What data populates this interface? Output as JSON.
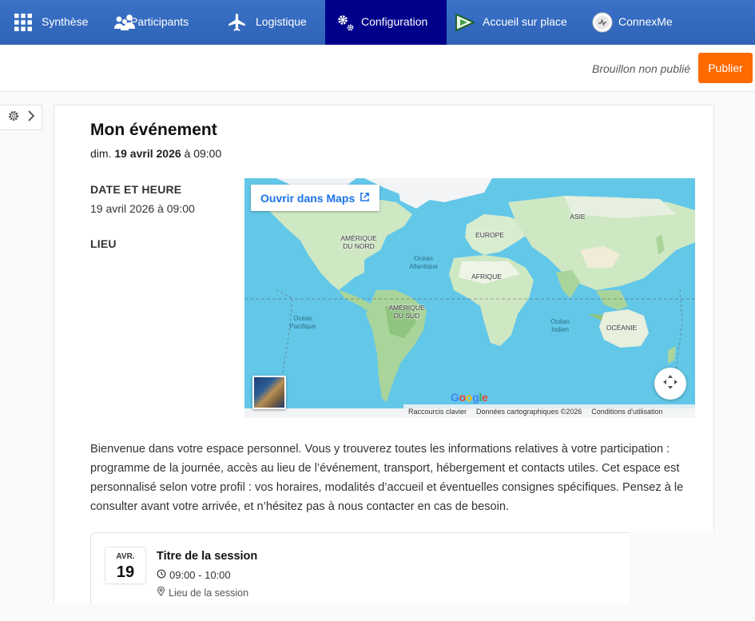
{
  "nav": {
    "items": [
      {
        "label": "Synthèse",
        "icon": "grid-icon"
      },
      {
        "label": "Participants",
        "icon": "people-icon"
      },
      {
        "label": "Logistique",
        "icon": "airplane-icon"
      },
      {
        "label": "Configuration",
        "icon": "gears-icon",
        "active": true
      },
      {
        "label": "Accueil sur place",
        "icon": "play-ticket-icon"
      },
      {
        "label": "ConnexMe",
        "icon": "connexme-logo-icon"
      }
    ]
  },
  "header": {
    "status": "Brouillon non publié",
    "publish_label": "Publier"
  },
  "event": {
    "title": "Mon événement",
    "when_prefix": "dim.",
    "when_date": "19 avril 2026",
    "when_suffix": "à 09:00",
    "date_label": "DATE ET HEURE",
    "date_value": "19 avril 2026 à 09:00",
    "place_label": "LIEU"
  },
  "map": {
    "open_link": "Ouvrir dans Maps",
    "labels": {
      "north_america": "AMÉRIQUE\nDU NORD",
      "south_america": "AMÉRIQUE\nDU SUD",
      "europe": "EUROPE",
      "africa": "AFRIQUE",
      "asia": "ASIE",
      "oceania": "OCÉANIE",
      "atlantic": "Océan\nAtlantique",
      "pacific": "Océan\nPacifique",
      "indian": "Océan\nIndien"
    },
    "brand": "Google",
    "footer": {
      "shortcuts": "Raccourcis clavier",
      "data": "Données cartographiques ©2026",
      "terms": "Conditions d'utilisation"
    },
    "colors": {
      "ocean": "#63c7e8",
      "land": "#cfe8c4",
      "land_dark": "#a9d59b",
      "ice": "#f2f4f6"
    }
  },
  "description": "Bienvenue dans votre espace personnel. Vous y trouverez toutes les informations relatives à votre participation : programme de la journée, accès au lieu de l’événement, transport, hébergement et contacts utiles. Cet espace est personnalisé selon votre profil : vos horaires, modalités d’accueil et éventuelles consignes spécifiques. Pensez à le consulter avant votre arrivée, et n’hésitez pas à nous contacter en cas de besoin.",
  "session": {
    "month": "AVR.",
    "day": "19",
    "title": "Titre de la session",
    "time": "09:00 - 10:00",
    "place": "Lieu de la session"
  },
  "colors": {
    "nav_bg": "#3a72c8",
    "nav_active": "#00008a",
    "publish": "#ff6a00",
    "link": "#1a73e8"
  }
}
